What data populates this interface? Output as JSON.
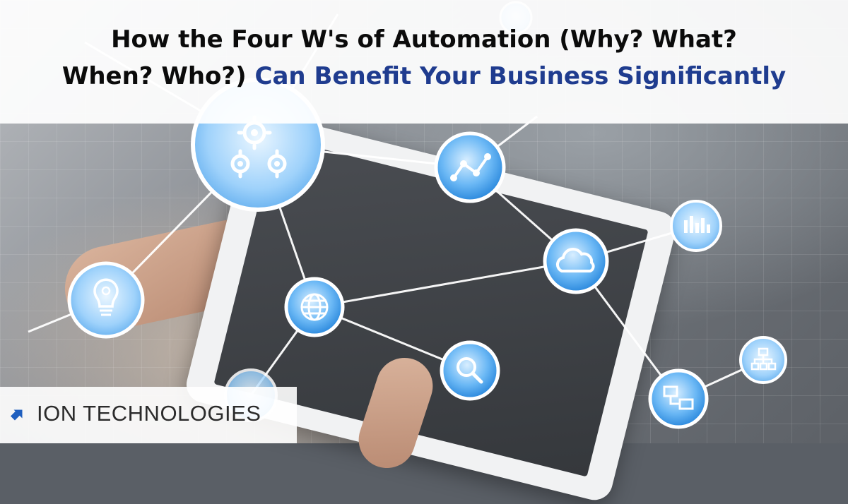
{
  "headline": {
    "line1": "How the Four W's of Automation (Why? What?",
    "line2_black": "When? Who?)",
    "line2_blue": "Can Benefit Your Business Significantly"
  },
  "brand": {
    "name": "ION TECHNOLOGIES"
  },
  "network_icons": [
    "gears-icon",
    "line-chart-icon",
    "equalizer-icon",
    "cloud-icon",
    "lightbulb-gears-icon",
    "globe-icon",
    "search-icon",
    "sitemap-icon",
    "network-computers-icon"
  ],
  "colors": {
    "headline_text": "#0b0b0b",
    "headline_accent": "#1f3c8f",
    "brand_accent": "#1f5fbf",
    "node_fill": "#2f8fe6",
    "node_ring": "#ffffff"
  }
}
